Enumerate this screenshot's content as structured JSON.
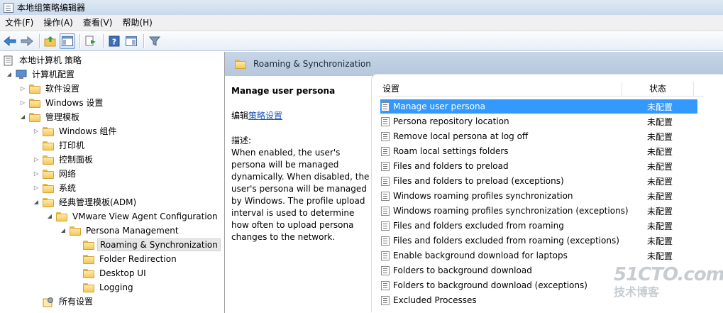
{
  "window": {
    "title": "本地组策略编辑器"
  },
  "menu": [
    "文件(F)",
    "操作(A)",
    "查看(V)",
    "帮助(H)"
  ],
  "tree": [
    {
      "label": "本地计算机 策略",
      "expander": ""
    },
    {
      "label": "计算机配置",
      "expander": "◢"
    },
    {
      "label": "软件设置",
      "expander": "▷"
    },
    {
      "label": "Windows 设置",
      "expander": "▷"
    },
    {
      "label": "管理模板",
      "expander": "◢"
    },
    {
      "label": "Windows 组件",
      "expander": "▷"
    },
    {
      "label": "打印机",
      "expander": ""
    },
    {
      "label": "控制面板",
      "expander": "▷"
    },
    {
      "label": "网络",
      "expander": "▷"
    },
    {
      "label": "系统",
      "expander": "▷"
    },
    {
      "label": "经典管理模板(ADM)",
      "expander": "◢"
    },
    {
      "label": "VMware View Agent Configuration",
      "expander": "◢"
    },
    {
      "label": "Persona Management",
      "expander": "◢"
    },
    {
      "label": "Roaming & Synchronization",
      "expander": ""
    },
    {
      "label": "Folder Redirection",
      "expander": ""
    },
    {
      "label": "Desktop UI",
      "expander": ""
    },
    {
      "label": "Logging",
      "expander": ""
    },
    {
      "label": "所有设置",
      "expander": ""
    }
  ],
  "breadcrumb": "Roaming & Synchronization",
  "description": {
    "title": "Manage user persona",
    "edit_prefix": "编辑",
    "edit_link": "策略设置",
    "label": "描述:",
    "text": "When enabled, the user's persona will be managed dynamically.  When disabled, the user's persona will be managed by Windows.  The profile upload interval is used to determine how often to upload persona changes to the network."
  },
  "list": {
    "col_setting": "设置",
    "col_state": "状态",
    "rows": [
      {
        "name": "Manage user persona",
        "state": "未配置"
      },
      {
        "name": "Persona repository location",
        "state": "未配置"
      },
      {
        "name": "Remove local persona at log off",
        "state": "未配置"
      },
      {
        "name": "Roam local settings folders",
        "state": "未配置"
      },
      {
        "name": "Files and folders to preload",
        "state": "未配置"
      },
      {
        "name": "Files and folders to preload (exceptions)",
        "state": "未配置"
      },
      {
        "name": "Windows roaming profiles synchronization",
        "state": "未配置"
      },
      {
        "name": "Windows roaming profiles synchronization (exceptions)",
        "state": "未配置"
      },
      {
        "name": "Files and folders excluded from roaming",
        "state": "未配置"
      },
      {
        "name": "Files and folders excluded from roaming (exceptions)",
        "state": "未配置"
      },
      {
        "name": "Enable background download for laptops",
        "state": "未配置"
      },
      {
        "name": "Folders to background download",
        "state": ""
      },
      {
        "name": "Folders to background download (exceptions)",
        "state": ""
      },
      {
        "name": "Excluded Processes",
        "state": ""
      }
    ]
  },
  "watermark": {
    "main": "51CTO.com",
    "sub": "技术博客"
  },
  "colors": {
    "selection": "#3399ff",
    "header_strip": "#bccbe0",
    "link": "#1a55b5"
  }
}
